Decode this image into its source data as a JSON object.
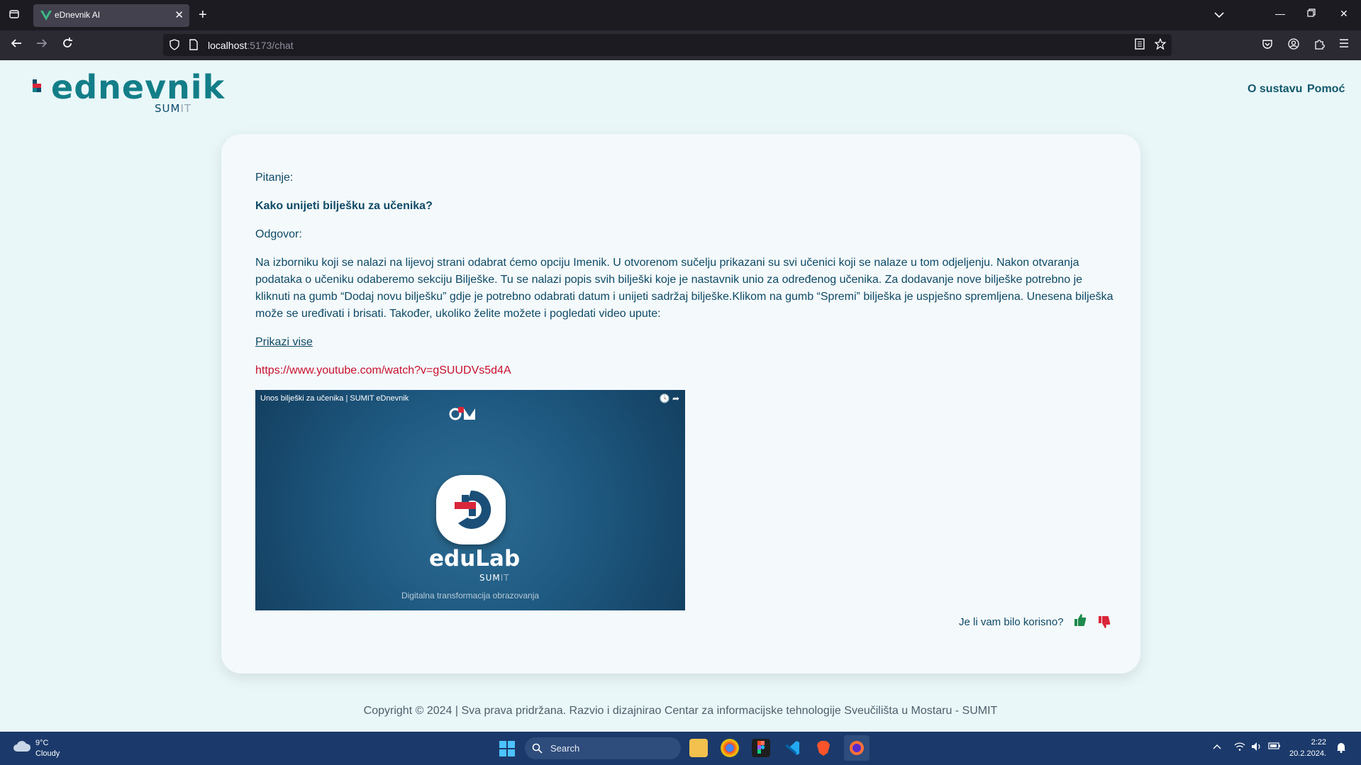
{
  "browser": {
    "tab_title": "eDnevnik AI",
    "url_host": "localhost",
    "url_path": ":5173/chat"
  },
  "header": {
    "logo_word": "ednevnik",
    "logo_sub_a": "SUM",
    "logo_sub_b": "IT",
    "nav": [
      "O sustavu",
      "Pomoć"
    ]
  },
  "chat": {
    "question_label": "Pitanje:",
    "question": "Kako unijeti bilješku za učenika?",
    "answer_label": "Odgovor:",
    "answer": "Na izborniku koji se nalazi na lijevoj strani odabrat ćemo opciju Imenik. U otvorenom sučelju prikazani su svi učenici koji se nalaze u tom odjeljenju. Nakon otvaranja podataka o učeniku odaberemo sekciju Bilješke. Tu se nalazi popis svih bilješki koje je nastavnik unio za određenog učenika. Za dodavanje nove bilješke potrebno je kliknuti na gumb “Dodaj novu bilješku” gdje je potrebno odabrati datum i unijeti sadržaj bilješke.Klikom na gumb “Spremi” bilješka je uspješno spremljena. Unesena bilješka može se uređivati i brisati. Također, ukoliko želite možete i pogledati video upute:",
    "more_link": "Prikazi vise",
    "video_url": "https://www.youtube.com/watch?v=gSUUDVs5d4A",
    "video": {
      "title": "Unos bilješki za učenika | SUMIT eDnevnik",
      "word": "eduLab",
      "sub_a": "SUM",
      "sub_b": "IT",
      "tagline": "Digitalna transformacija obrazovanja"
    },
    "feedback_question": "Je li vam bilo korisno?"
  },
  "footer": "Copyright © 2024 | Sva prava pridržana. Razvio i dizajnirao Centar za informacijske tehnologije Sveučilišta u Mostaru - SUMIT",
  "taskbar": {
    "weather_temp": "9°C",
    "weather_cond": "Cloudy",
    "search_placeholder": "Search",
    "time": "2:22",
    "date": "20.2.2024."
  },
  "colors": {
    "brand_teal": "#137e88",
    "text_navy": "#0e4a66",
    "link_red": "#c8102e",
    "like_green": "#1e8a4c",
    "dislike_red": "#d9263a"
  }
}
